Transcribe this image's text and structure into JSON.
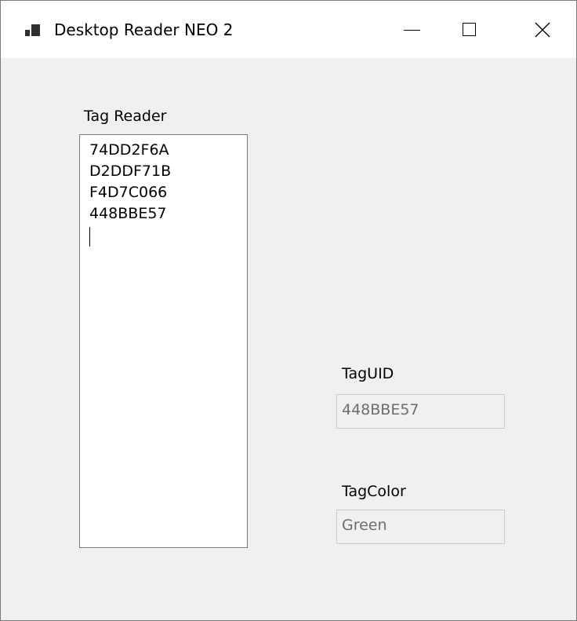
{
  "window": {
    "title": "Desktop Reader NEO 2",
    "icon": "app-window-icon",
    "controls": {
      "minimize": "minimize-icon",
      "maximize": "maximize-icon",
      "close": "close-icon"
    }
  },
  "tag_reader": {
    "label": "Tag Reader",
    "lines": [
      "74DD2F6A",
      "D2DDF71B",
      "F4D7C066",
      "448BBE57"
    ]
  },
  "tag_uid": {
    "label": "TagUID",
    "value": "448BBE57"
  },
  "tag_color": {
    "label": "TagColor",
    "value": "Green"
  }
}
